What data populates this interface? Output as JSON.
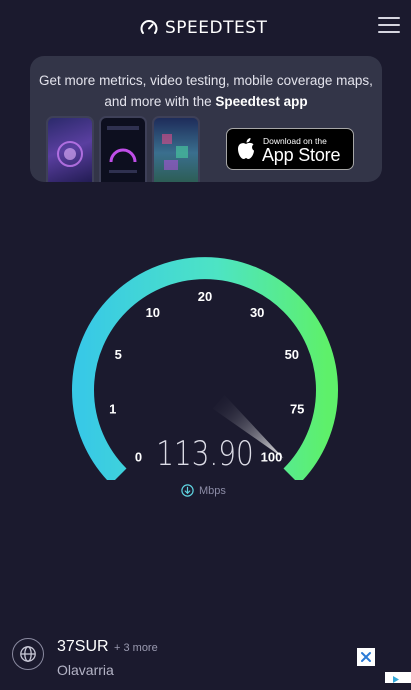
{
  "header": {
    "brand": "SPEEDTEST",
    "logo_icon": "speedometer-icon",
    "menu_icon": "hamburger-menu-icon"
  },
  "promo": {
    "text_before": "Get more metrics, video testing, mobile coverage maps, and more with the",
    "text_bold": "Speedtest app",
    "appstore_small": "Download on the",
    "appstore_big": "App Store"
  },
  "gauge": {
    "labels": [
      "0",
      "1",
      "5",
      "10",
      "20",
      "30",
      "50",
      "75",
      "100"
    ],
    "max_label": "100",
    "value": "113.90",
    "unit": "Mbps",
    "needle_position": "at 100 mark (max)",
    "colors": {
      "start": "#3ecfe0",
      "mid": "#4fe3c6",
      "end": "#5cf06e"
    }
  },
  "server": {
    "name": "37SUR",
    "more": "+ 3 more",
    "location": "Olavarria"
  }
}
